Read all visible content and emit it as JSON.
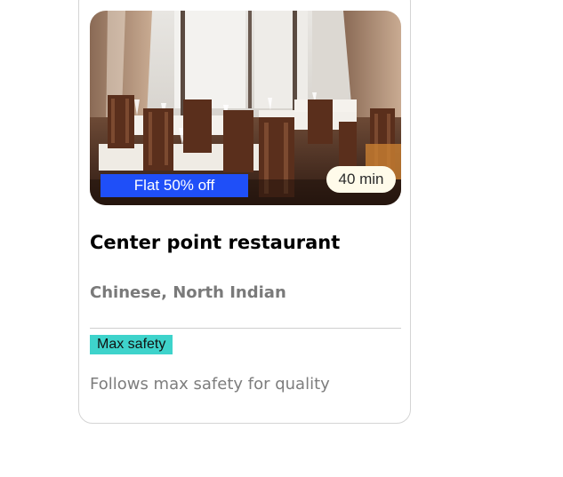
{
  "card": {
    "image_alt": "restaurant dining room",
    "offer_label": "Flat 50% off",
    "time_label": "40 min",
    "name": "Center point restaurant",
    "cuisine": "Chinese, North Indian",
    "safety_badge": "Max safety",
    "safety_text": "Follows max safety for quality"
  },
  "colors": {
    "offer_bg": "#1f4ff8",
    "time_bg": "#fffbea",
    "safety_bg": "#3ed3cb",
    "muted_text": "#7a7a7a"
  }
}
